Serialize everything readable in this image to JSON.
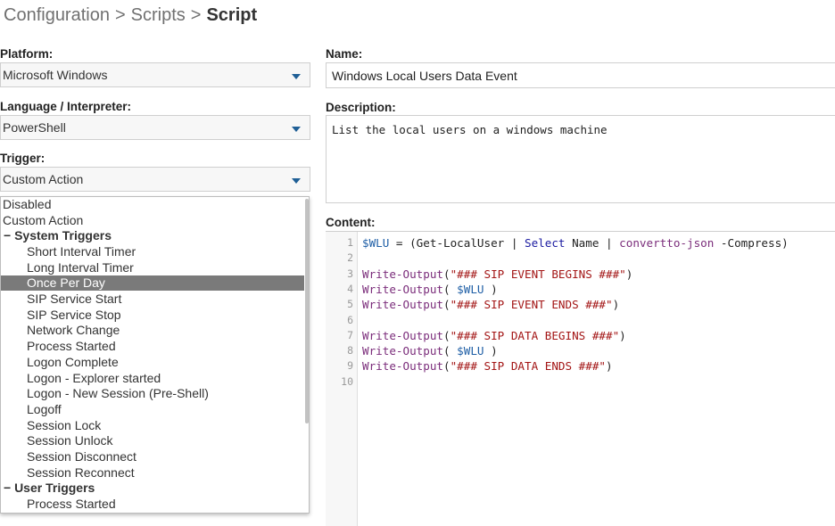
{
  "breadcrumb": {
    "items": [
      "Configuration",
      "Scripts"
    ],
    "separator": ">",
    "current": "Script"
  },
  "form": {
    "platform": {
      "label": "Platform:",
      "value": "Microsoft Windows"
    },
    "language": {
      "label": "Language / Interpreter:",
      "value": "PowerShell"
    },
    "trigger": {
      "label": "Trigger:",
      "value": "Custom Action"
    },
    "name": {
      "label": "Name:",
      "value": "Windows Local Users Data Event"
    },
    "description": {
      "label": "Description:",
      "value": "List the local users on a windows machine"
    },
    "content": {
      "label": "Content:"
    }
  },
  "trigger_dropdown": {
    "items": [
      {
        "text": "Disabled",
        "kind": "top"
      },
      {
        "text": "Custom Action",
        "kind": "top"
      },
      {
        "text": "− System Triggers",
        "kind": "group"
      },
      {
        "text": "Short Interval Timer",
        "kind": "indent"
      },
      {
        "text": "Long Interval Timer",
        "kind": "indent"
      },
      {
        "text": "Once Per Day",
        "kind": "indent",
        "selected": true
      },
      {
        "text": "SIP Service Start",
        "kind": "indent"
      },
      {
        "text": "SIP Service Stop",
        "kind": "indent"
      },
      {
        "text": "Network Change",
        "kind": "indent"
      },
      {
        "text": "Process Started",
        "kind": "indent"
      },
      {
        "text": "Logon Complete",
        "kind": "indent"
      },
      {
        "text": "Logon - Explorer started",
        "kind": "indent"
      },
      {
        "text": "Logon - New Session (Pre-Shell)",
        "kind": "indent"
      },
      {
        "text": "Logoff",
        "kind": "indent"
      },
      {
        "text": "Session Lock",
        "kind": "indent"
      },
      {
        "text": "Session Unlock",
        "kind": "indent"
      },
      {
        "text": "Session Disconnect",
        "kind": "indent"
      },
      {
        "text": "Session Reconnect",
        "kind": "indent"
      },
      {
        "text": "− User Triggers",
        "kind": "group"
      },
      {
        "text": "Process Started",
        "kind": "indent"
      }
    ]
  },
  "editor": {
    "lines": [
      [
        {
          "t": "$WLU",
          "c": "var"
        },
        {
          "t": " = (Get-LocalUser | ",
          "c": "plain"
        },
        {
          "t": "Select",
          "c": "kw"
        },
        {
          "t": " Name | ",
          "c": "plain"
        },
        {
          "t": "convertto-json",
          "c": "fn"
        },
        {
          "t": " -Compress)",
          "c": "plain"
        }
      ],
      [],
      [
        {
          "t": "Write-Output",
          "c": "fn"
        },
        {
          "t": "(",
          "c": "plain"
        },
        {
          "t": "\"### SIP EVENT BEGINS ###\"",
          "c": "str"
        },
        {
          "t": ")",
          "c": "plain"
        }
      ],
      [
        {
          "t": "Write-Output",
          "c": "fn"
        },
        {
          "t": "( ",
          "c": "plain"
        },
        {
          "t": "$WLU",
          "c": "var"
        },
        {
          "t": " )",
          "c": "plain"
        }
      ],
      [
        {
          "t": "Write-Output",
          "c": "fn"
        },
        {
          "t": "(",
          "c": "plain"
        },
        {
          "t": "\"### SIP EVENT ENDS ###\"",
          "c": "str"
        },
        {
          "t": ")",
          "c": "plain"
        }
      ],
      [],
      [
        {
          "t": "Write-Output",
          "c": "fn"
        },
        {
          "t": "(",
          "c": "plain"
        },
        {
          "t": "\"### SIP DATA BEGINS ###\"",
          "c": "str"
        },
        {
          "t": ")",
          "c": "plain"
        }
      ],
      [
        {
          "t": "Write-Output",
          "c": "fn"
        },
        {
          "t": "( ",
          "c": "plain"
        },
        {
          "t": "$WLU",
          "c": "var"
        },
        {
          "t": " )",
          "c": "plain"
        }
      ],
      [
        {
          "t": "Write-Output",
          "c": "fn"
        },
        {
          "t": "(",
          "c": "plain"
        },
        {
          "t": "\"### SIP DATA ENDS ###\"",
          "c": "str"
        },
        {
          "t": ")",
          "c": "plain"
        }
      ],
      []
    ]
  },
  "colors": {
    "accent": "#1f5f96",
    "selected_bg": "#7a7a7a",
    "code_var": "#1f5fa6",
    "code_fn": "#7b2d7b",
    "code_string": "#a31515",
    "code_keyword": "#1a1aa0"
  },
  "icons": {
    "select_arrow": "chevron-down-icon",
    "group_toggle": "collapse-icon"
  }
}
